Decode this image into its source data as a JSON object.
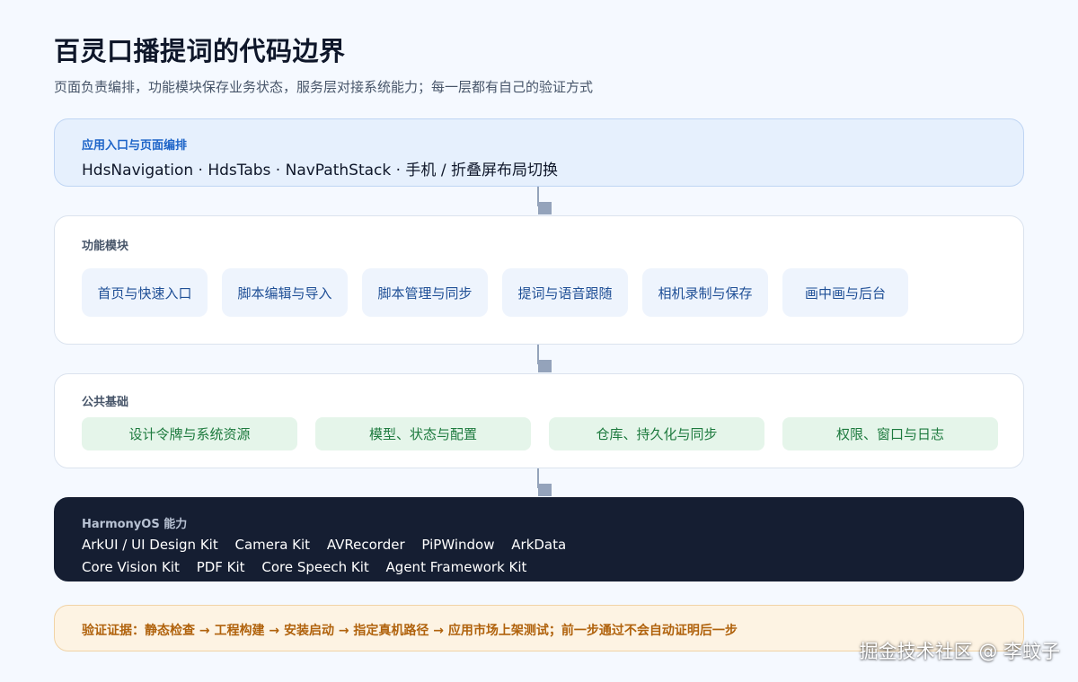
{
  "title": "百灵口播提词的代码边界",
  "subtitle": "页面负责编排，功能模块保存业务状态，服务层对接系统能力；每一层都有自己的验证方式",
  "entry_layer": {
    "label": "应用入口与页面编排",
    "text": "HdsNavigation · HdsTabs · NavPathStack · 手机 / 折叠屏布局切换"
  },
  "modules_layer": {
    "label": "功能模块",
    "items": [
      "首页与快速入口",
      "脚本编辑与导入",
      "脚本管理与同步",
      "提词与语音跟随",
      "相机录制与保存",
      "画中画与后台"
    ]
  },
  "common_layer": {
    "label": "公共基础",
    "items": [
      "设计令牌与系统资源",
      "模型、状态与配置",
      "仓库、持久化与同步",
      "权限、窗口与日志"
    ]
  },
  "os_layer": {
    "label": "HarmonyOS 能力",
    "row1": [
      "ArkUI / UI Design Kit",
      "Camera Kit",
      "AVRecorder",
      "PiPWindow",
      "ArkData"
    ],
    "row2": [
      "Core Vision Kit",
      "PDF Kit",
      "Core Speech Kit",
      "Agent Framework Kit"
    ]
  },
  "verification": {
    "text": "验证证据：静态检查 → 工程构建 → 安装启动 → 指定真机路径 → 应用市场上架测试；前一步通过不会自动证明后一步"
  },
  "watermark": "掘金技术社区 @ 李蚊子",
  "colors": {
    "background": "#f5f9ff",
    "entry_bg": "#e6f0fd",
    "entry_label": "#1d64c8",
    "module_chip_bg": "#eef4fd",
    "module_chip_text": "#1f4f96",
    "common_chip_bg": "#e5f5ea",
    "common_chip_text": "#1d7a3e",
    "os_bg": "#151e32",
    "verify_bg": "#fdf3e3",
    "verify_text": "#b0620c",
    "connector": "#94a3bb"
  },
  "icons": {
    "connector": "down-arrow-icon"
  }
}
